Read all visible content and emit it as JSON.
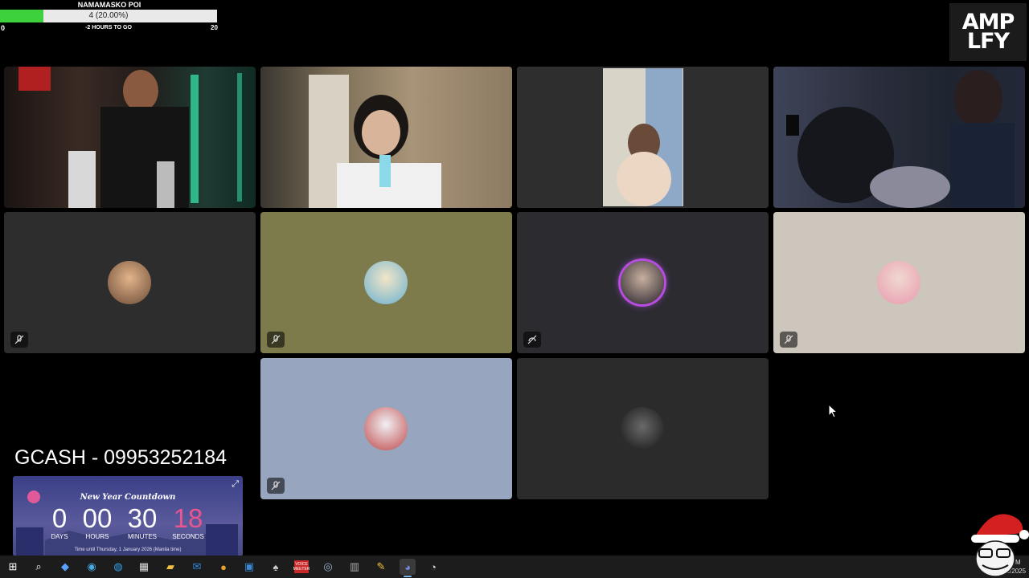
{
  "goal": {
    "title": "NAMAMASKO POI",
    "progress_text": "4 (20.00%)",
    "progress_fraction": 0.2,
    "min": "0",
    "subtitle": "-2 HOURS TO GO",
    "max": "20"
  },
  "window_controls": {
    "minimize": "–",
    "maximize": "□",
    "close": "×"
  },
  "logo": {
    "text": "AMP\nLFY"
  },
  "gcash": "GCASH - 09953252184",
  "countdown": {
    "title": "New Year Countdown",
    "days": "0",
    "days_label": "DAYS",
    "hours": "00",
    "hours_label": "HOURS",
    "minutes": "30",
    "minutes_label": "MINUTES",
    "seconds": "18",
    "seconds_label": "SECONDS",
    "footer": "Time until Thursday, 1 January 2026 (Manila time)",
    "expand_icon": "expand-icon",
    "seconds_color": "#e8558f"
  },
  "tiles": [
    {
      "kind": "video",
      "speaking": false,
      "bg": "#2a2420"
    },
    {
      "kind": "video",
      "speaking": false,
      "bg": "#8a7a62"
    },
    {
      "kind": "video",
      "speaking": true,
      "bg": "#2e2e2e"
    },
    {
      "kind": "video",
      "speaking": false,
      "bg": "#3a3a46"
    },
    {
      "kind": "avatar",
      "bg": "#2d2d2d",
      "muted": true
    },
    {
      "kind": "avatar",
      "bg": "#7d7b4c",
      "muted": true
    },
    {
      "kind": "avatar",
      "bg": "#2b2b30",
      "muted": true
    },
    {
      "kind": "avatar",
      "bg": "#cdc6bc",
      "muted": true
    },
    {
      "kind": "avatar",
      "bg": "#98a5bf",
      "muted": true
    },
    {
      "kind": "avatar",
      "bg": "#2b2b2b",
      "muted": false
    }
  ],
  "colors": {
    "goal_fill": "#3ed13e",
    "speaking_border": "#3fb950",
    "taskbar": "#1c1c1c"
  },
  "taskbar": {
    "icons": [
      "windows-start-icon",
      "search-icon",
      "copilot-icon",
      "edge-beta-icon",
      "edge-icon",
      "store-icon",
      "file-explorer-icon",
      "outlook-icon",
      "chrome-icon",
      "app-blue-icon",
      "game-icon",
      "voice-meeter-icon",
      "steam-icon",
      "device-icon",
      "tools-icon",
      "discord-icon",
      "obs-icon"
    ],
    "voice_label": "VOICE\nMEETER",
    "time": "11:29 PM",
    "date": "31/12/2025"
  }
}
